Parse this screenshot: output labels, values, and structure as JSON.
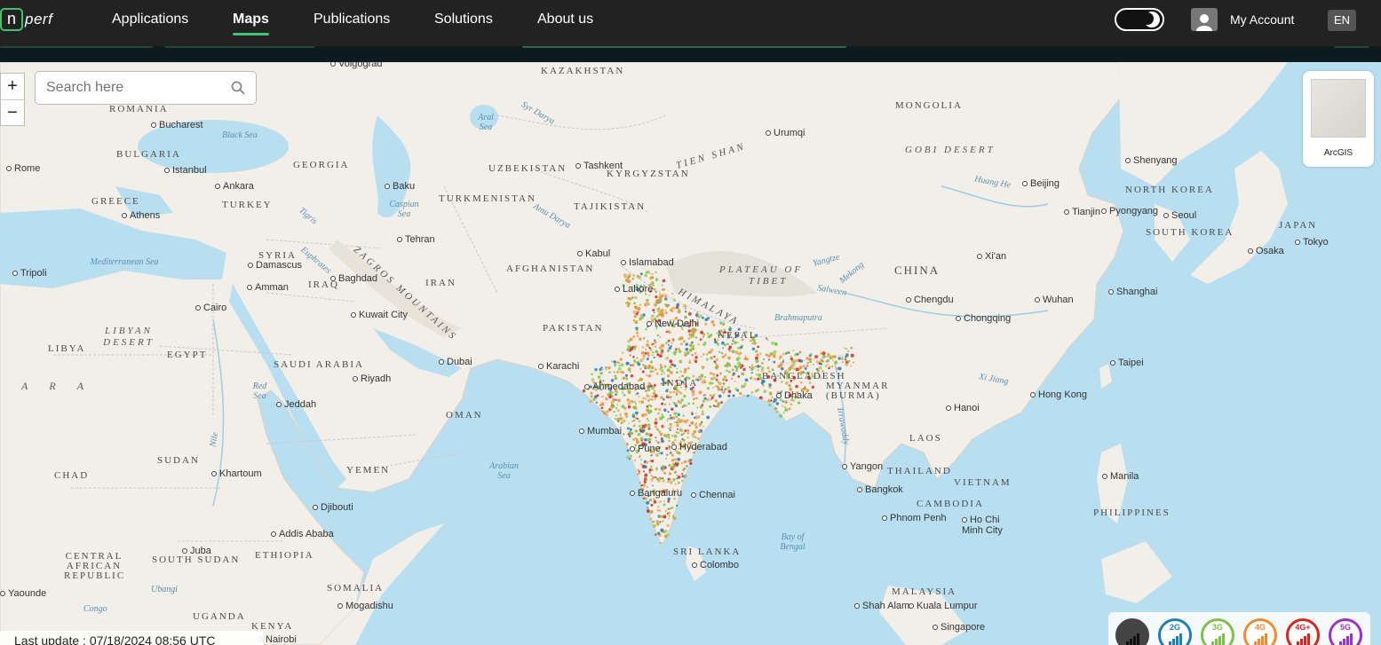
{
  "nav": {
    "logo_letter": "n",
    "logo_text": "perf",
    "items": [
      {
        "label": "Applications"
      },
      {
        "label": "Maps"
      },
      {
        "label": "Publications"
      },
      {
        "label": "Solutions"
      },
      {
        "label": "About us"
      }
    ],
    "active": "Maps",
    "account_label": "My Account",
    "language": "EN"
  },
  "map": {
    "search_placeholder": "Search here",
    "zoom_in": "+",
    "zoom_out": "−",
    "basemap_label": "ArcGIS",
    "last_update": "Last update : 07/18/2024 08:56 UTC",
    "countries": [
      "KAZAKHSTAN",
      "MONGOLIA",
      "ROMANIA",
      "BULGARIA",
      "GEORGIA",
      "UZBEKISTAN",
      "KYRGYZSTAN",
      "TURKMENISTAN",
      "TAJIKISTAN",
      "GREECE",
      "TURKEY",
      "NORTH KOREA",
      "SOUTH KOREA",
      "JAPAN",
      "CHINA",
      "AFGHANISTAN",
      "IRAN",
      "SYRIA",
      "IRAQ",
      "PAKISTAN",
      "NEPAL",
      "TIBET",
      "INDIA",
      "BANGLADESH",
      "MYANMAR (BURMA)",
      "LIBYA",
      "EGYPT",
      "SAUDI ARABIA",
      "OMAN",
      "LAOS",
      "THAILAND",
      "VIETNAM",
      "CAMBODIA",
      "PHILIPPINES",
      "SUDAN",
      "CHAD",
      "YEMEN",
      "SOUTH SUDAN",
      "ETHIOPIA",
      "SOMALIA",
      "CENTRAL AFRICAN REPUBLIC",
      "UGANDA",
      "KENYA",
      "SRI LANKA",
      "MALAYSIA"
    ],
    "cities": [
      "Volgograd",
      "Bucharest",
      "Rome",
      "Istanbul",
      "Ankara",
      "Athens",
      "Baku",
      "Tashkent",
      "Urumqi",
      "Shenyang",
      "Beijing",
      "Tianjin",
      "Pyongyang",
      "Seoul",
      "Tokyo",
      "Osaka",
      "Xi'an",
      "Shanghai",
      "Chengdu",
      "Chongqing",
      "Wuhan",
      "Taipei",
      "Hong Kong",
      "Hanoi",
      "Tehran",
      "Kabul",
      "Islamabad",
      "Lahore",
      "New Delhi",
      "Damascus",
      "Amman",
      "Baghdad",
      "Kuwait City",
      "Cairo",
      "Riyadh",
      "Jeddah",
      "Dubai",
      "Karachi",
      "Ahmedabad",
      "Mumbai",
      "Pune",
      "Hyderabad",
      "Bangaluru",
      "Chennai",
      "Colombo",
      "Dhaka",
      "Yangon",
      "Bangkok",
      "Phnom Penh",
      "Ho Chi Minh City",
      "Manila",
      "Khartoum",
      "Djibouti",
      "Addis Ababa",
      "Juba",
      "Mogadishu",
      "Kuala Lumpur",
      "Singapore",
      "Shah Alam",
      "Nairobi",
      "Yaounde",
      "Tripoli"
    ],
    "regions": [
      "GOBI DESERT",
      "PLATEAU OF",
      "TIBET",
      "HIMALAYA",
      "ZAGROS MOUNTAINS",
      "LIBYAN DESERT",
      "TIEN SHAN",
      "ARA"
    ],
    "seas": [
      "Black Sea",
      "Caspian Sea",
      "Aral Sea",
      "Mediterranean Sea",
      "Red Sea",
      "Arabian Sea",
      "Bay of Bengal",
      "Syr Darya",
      "Amu Darya",
      "Tigris",
      "Euphrates",
      "Brahmaputra",
      "Yangtze",
      "Mekong",
      "Salween",
      "Huang He",
      "Xi Jiang",
      "Irrawaddy",
      "Nile",
      "Ubangi",
      "Congo"
    ]
  },
  "legend": [
    {
      "label": "all",
      "color": "#333333"
    },
    {
      "label": "2G",
      "color": "#1a7fc1"
    },
    {
      "label": "3G",
      "color": "#7dc242"
    },
    {
      "label": "4G",
      "color": "#f08c2a"
    },
    {
      "label": "4G+",
      "color": "#e0211d"
    },
    {
      "label": "5G",
      "color": "#9b2fd6"
    }
  ],
  "colors": {
    "accent": "#3ec46d",
    "nav_bg": "#222222",
    "water": "#b8dff0",
    "land": "#f1efe8"
  }
}
